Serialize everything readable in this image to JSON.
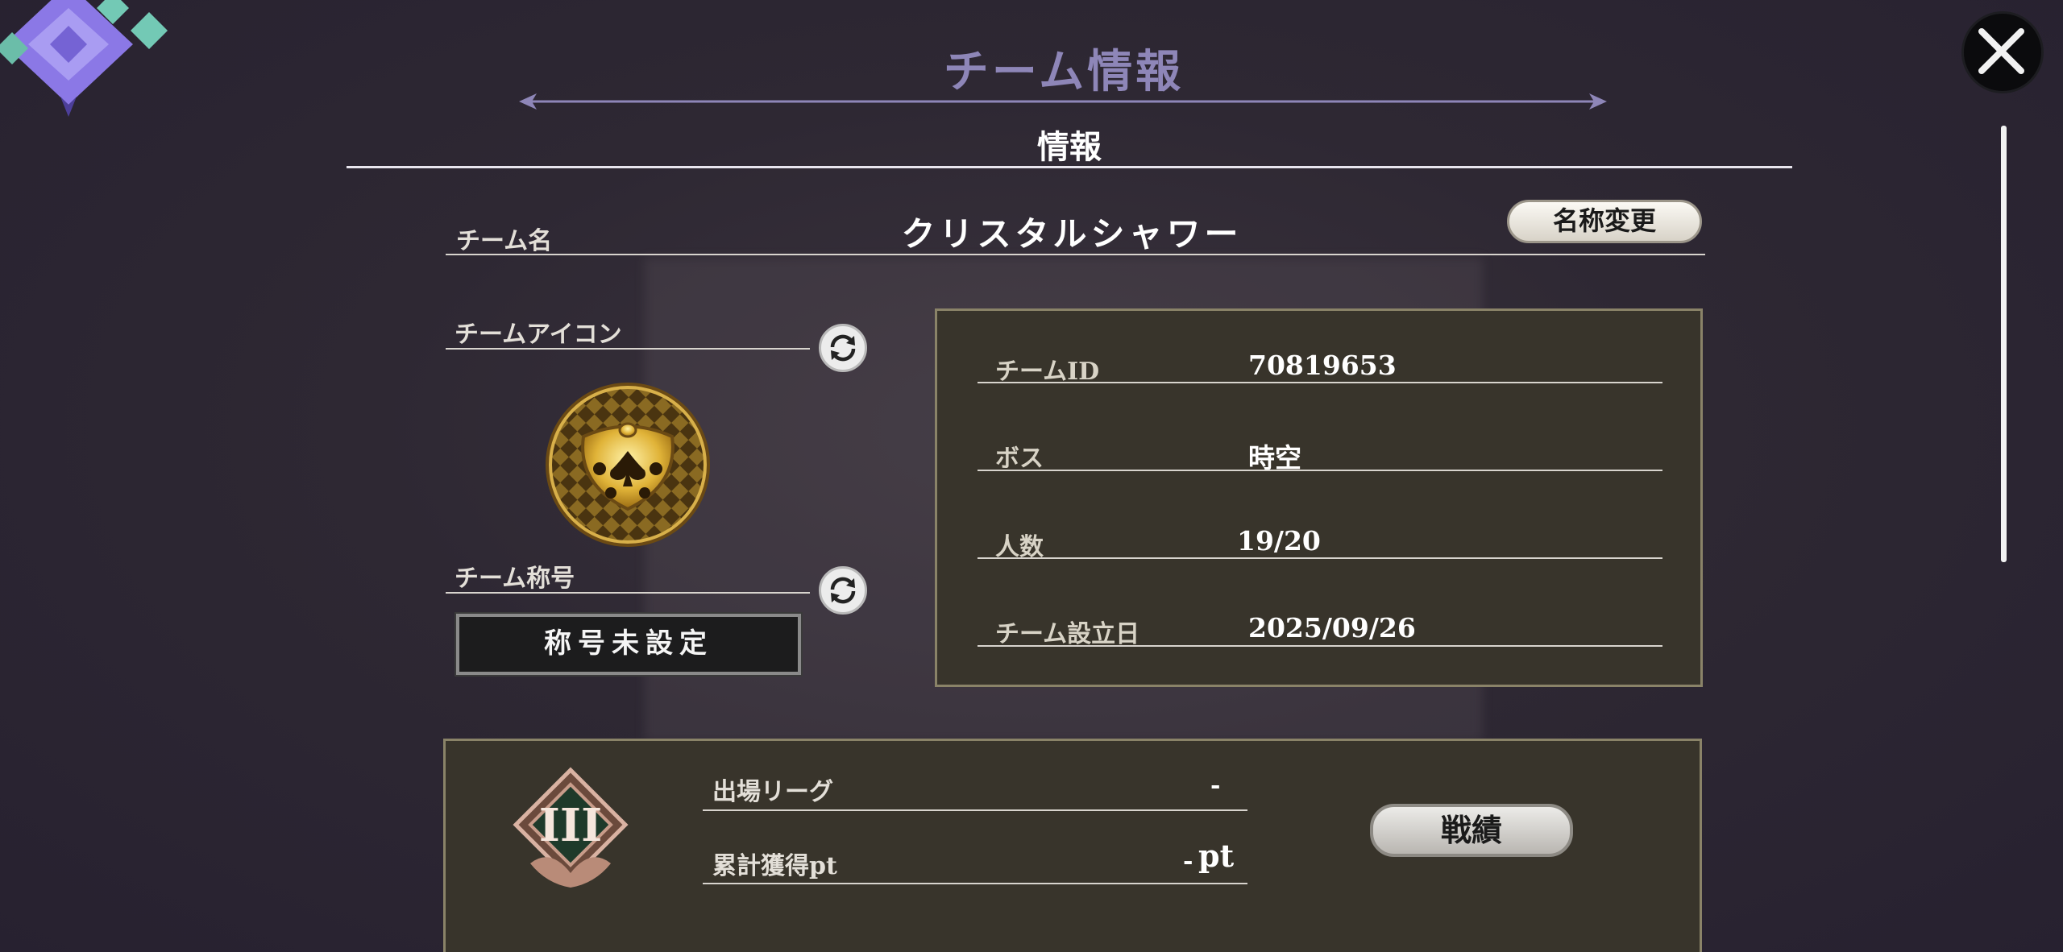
{
  "header": {
    "title": "チーム情報",
    "tab_title": "情報"
  },
  "team_name": {
    "label": "チーム名",
    "value": "クリスタルシャワー",
    "rename_button": "名称変更"
  },
  "team_icon": {
    "label": "チームアイコン",
    "icon": "gold-spade-emblem"
  },
  "team_title": {
    "label": "チーム称号",
    "value": "称号未設定"
  },
  "info": {
    "id_label": "チームID",
    "id_value": "70819653",
    "boss_label": "ボス",
    "boss_value": "時空",
    "members_label": "人数",
    "members_value": "19/20",
    "founded_label": "チーム設立日",
    "founded_value": "2025/09/26"
  },
  "league": {
    "rank_icon": "rank-III-emblem",
    "league_label": "出場リーグ",
    "league_value": "-",
    "points_label": "累計獲得pt",
    "points_value": "-",
    "points_unit": "pt",
    "record_button": "戦績"
  },
  "icons": {
    "close": "close-icon",
    "refresh": "refresh-icon",
    "corner": "crystal-emblem-icon"
  },
  "colors": {
    "background": "#2e2833",
    "title_purple": "#8e86b8",
    "panel": "#38342b",
    "panel_border": "#8a8368"
  }
}
